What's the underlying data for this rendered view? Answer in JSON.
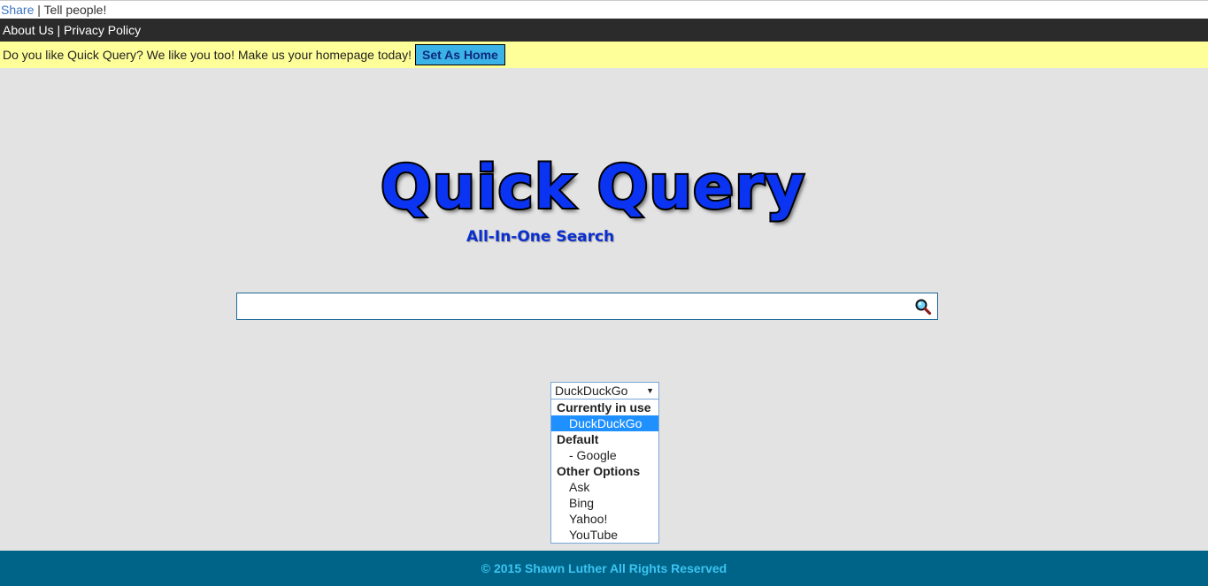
{
  "share_bar": {
    "share_label": "Share",
    "separator": " | ",
    "tell_label": "Tell people!"
  },
  "nav": {
    "about_label": "About Us",
    "separator": " | ",
    "privacy_label": "Privacy Policy"
  },
  "promo": {
    "message": "Do you like Quick Query? We like you too! Make us your homepage today!",
    "button_label": "Set As Home"
  },
  "logo": {
    "title": "Quick Query",
    "subtitle": "All-In-One Search"
  },
  "search": {
    "value": "",
    "placeholder": "",
    "button_icon": "search-icon"
  },
  "engine_select": {
    "selected": "DuckDuckGo",
    "groups": [
      {
        "label": "Currently in use",
        "options": [
          "DuckDuckGo"
        ]
      },
      {
        "label": "Default",
        "options": [
          "- Google"
        ]
      },
      {
        "label": "Other Options",
        "options": [
          "Ask",
          "Bing",
          "Yahoo!",
          "YouTube"
        ]
      }
    ]
  },
  "footer": {
    "copyright": "© 2015 Shawn Luther All Rights Reserved"
  },
  "colors": {
    "background": "#e3e3e3",
    "nav_bg": "#2b2b2b",
    "promo_bg": "#ffff99",
    "button_bg": "#3bb3e6",
    "logo_blue": "#0a34f2",
    "footer_bg": "#006488",
    "footer_text": "#3cc4f2",
    "select_highlight": "#1e90ff"
  }
}
